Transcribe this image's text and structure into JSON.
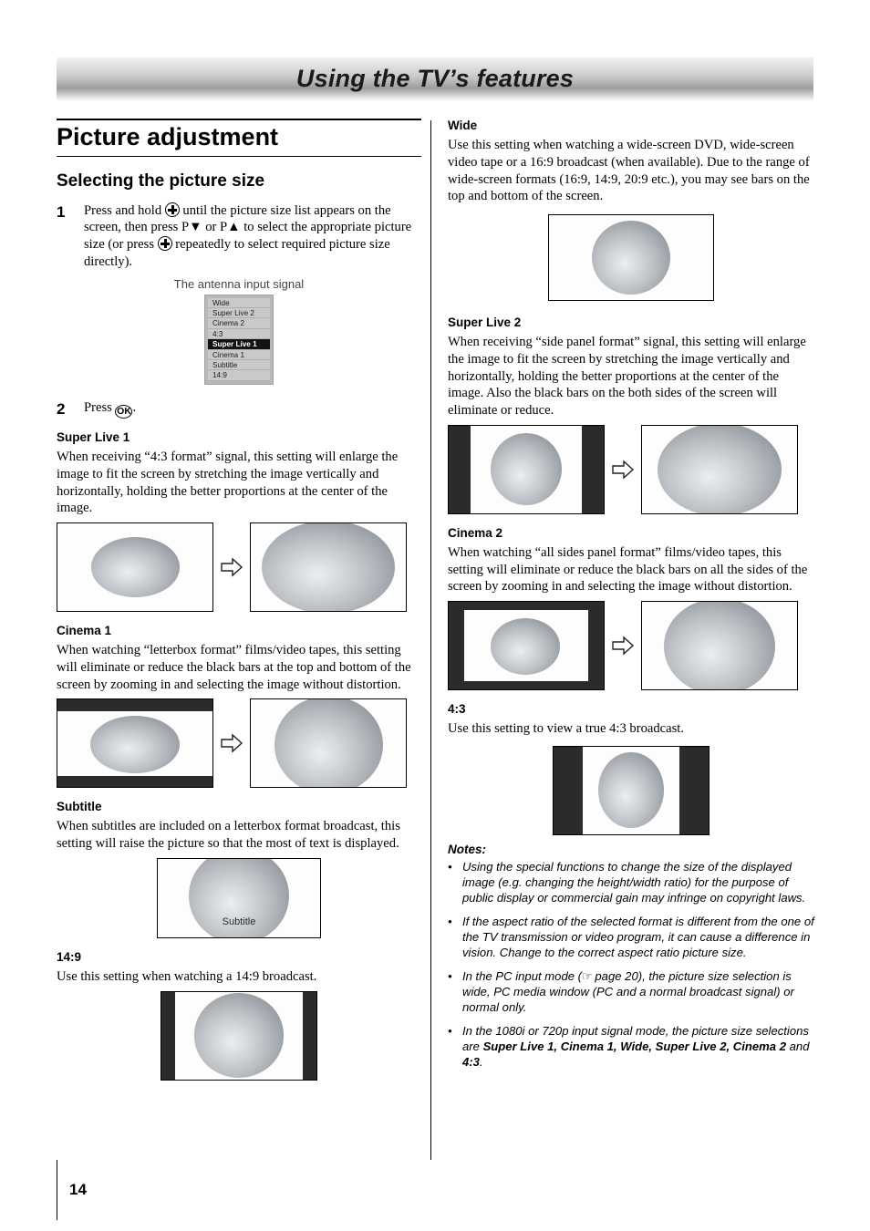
{
  "running_head": {
    "title": "Using the TV’s features"
  },
  "page_number": "14",
  "section": {
    "title": "Picture adjustment",
    "subtitle": "Selecting the picture size"
  },
  "steps": [
    {
      "num": "1",
      "text_1": "Press and hold ",
      "text_2": " until the picture size list appears on the screen, then press P▼ or P▲ to select the appropriate picture size (or press ",
      "text_3": " repeatedly to select required picture size directly)."
    },
    {
      "num": "2",
      "text_1": "Press ",
      "text_3": "."
    }
  ],
  "osd": {
    "caption": "The antenna input signal",
    "items": [
      "Wide",
      "Super Live 2",
      "Cinema 2",
      "4:3",
      "Super Live 1",
      "Cinema 1",
      "Subtitle",
      "14:9"
    ],
    "selected": "Super Live 1"
  },
  "topics_left": [
    {
      "heading": "Super Live 1",
      "body": "When receiving “4:3 format” signal, this setting will enlarge the image to fit the screen by stretching the image vertically and horizontally, holding the better proportions at the center of the image."
    },
    {
      "heading": "Cinema 1",
      "body": "When watching “letterbox format” films/video tapes, this setting will eliminate or reduce the black bars at the top and bottom of the screen by zooming in and selecting the image without distortion."
    },
    {
      "heading": "Subtitle",
      "body": "When subtitles are included on a letterbox format broadcast, this setting will raise the picture so that the most of text is displayed.",
      "figure_label": "Subtitle"
    },
    {
      "heading": "14:9",
      "body": "Use this setting when watching a 14:9 broadcast."
    }
  ],
  "topics_right": [
    {
      "heading": "Wide",
      "body": "Use this setting when watching a wide-screen DVD, wide-screen video tape or a 16:9 broadcast (when available). Due to the range of wide-screen formats (16:9, 14:9, 20:9 etc.), you may see bars on the top and bottom of the screen."
    },
    {
      "heading": "Super Live 2",
      "body": "When receiving “side panel format” signal, this setting will enlarge the image to fit the screen by stretching the image vertically and horizontally, holding the better proportions at the center of the image. Also the black bars on the both sides of the screen will eliminate or reduce."
    },
    {
      "heading": "Cinema 2",
      "body": "When watching “all sides panel format” films/video tapes, this setting will eliminate or reduce the black bars on all the sides of the screen by zooming in and selecting the image without distortion."
    },
    {
      "heading": "4:3",
      "body": "Use this setting to view a true 4:3 broadcast."
    }
  ],
  "notes": {
    "heading": "Notes:",
    "bullet": "•",
    "items": [
      {
        "text": "Using the special functions to change the size of the displayed image (e.g. changing the height/width ratio) for the purpose of public display or commercial gain may infringe on copyright laws."
      },
      {
        "text": "If the aspect ratio of the selected format is different from the one of the TV transmission or video program, it can cause a difference in vision. Change to the correct aspect ratio picture size."
      },
      {
        "text_a": "In the PC input mode (",
        "hand": "☞",
        "text_b": " page 20), the picture size selection is wide, PC media window (PC and a normal broadcast signal) or normal only."
      },
      {
        "text_a": "In the 1080i or 720p input signal mode, the picture size selections are ",
        "bold_list": "Super Live 1, Cinema 1, Wide, Super Live 2, Cinema 2",
        "mid": " and ",
        "bold_last": "4:3",
        "text_b": "."
      }
    ]
  },
  "keys": {
    "picture_size_label": "picture-size-key",
    "ok_label": "OK"
  }
}
